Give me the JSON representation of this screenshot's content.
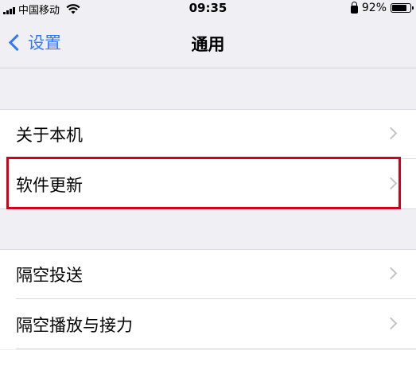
{
  "status_bar": {
    "carrier": "中国移动",
    "time": "09:35",
    "battery_percent_text": "92%",
    "battery_level": 0.92,
    "icons": [
      "signal-icon",
      "wifi-icon",
      "orientation-lock-icon",
      "battery-icon"
    ]
  },
  "nav": {
    "back_label": "设置",
    "title": "通用"
  },
  "groups": [
    {
      "items": [
        {
          "label": "关于本机"
        },
        {
          "label": "软件更新",
          "highlighted": true
        }
      ]
    },
    {
      "items": [
        {
          "label": "隔空投送"
        },
        {
          "label": "隔空播放与接力"
        },
        {
          "label": ""
        }
      ]
    }
  ],
  "colors": {
    "accent": "#3478f6",
    "background": "#efeff4",
    "highlight": "#d0021b",
    "chevron": "#c4c4c8"
  }
}
